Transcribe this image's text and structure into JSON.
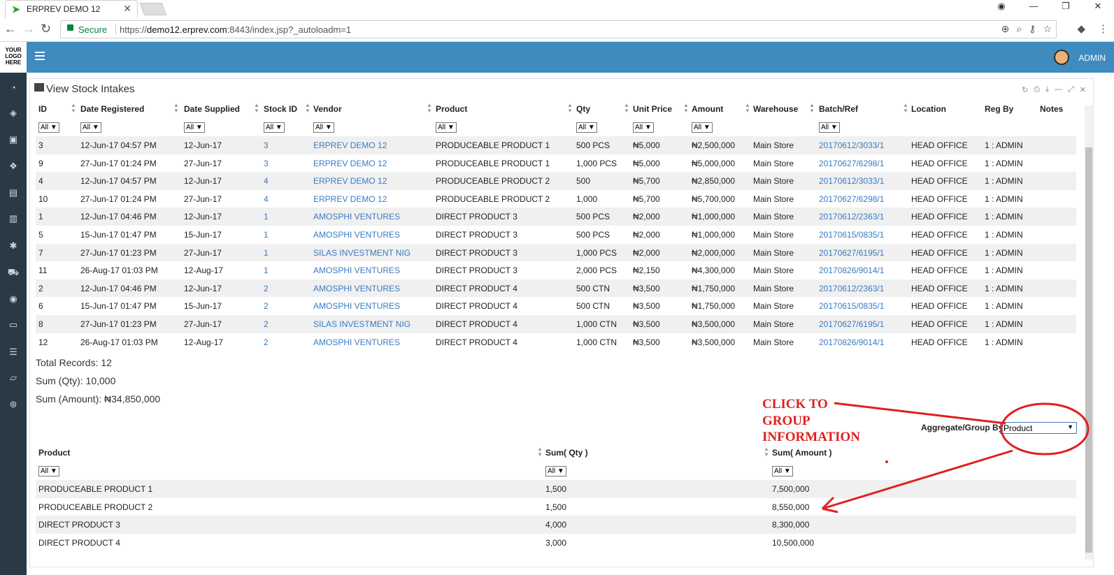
{
  "browser": {
    "tab_title": "ERPREV DEMO 12",
    "secure_label": "Secure",
    "url_scheme": "https://",
    "url_host": "demo12.erprev.com",
    "url_rest": ":8443/index.jsp?_autoloadm=1"
  },
  "app": {
    "logo_text": "YOUR LOGO HERE",
    "user": "ADMIN",
    "panel_title": "View Stock Intakes"
  },
  "table": {
    "columns": [
      "ID",
      "Date Registered",
      "Date Supplied",
      "Stock ID",
      "Vendor",
      "Product",
      "Qty",
      "Unit Price",
      "Amount",
      "Warehouse",
      "Batch/Ref",
      "Location",
      "Reg By",
      "Notes"
    ],
    "filter_label": "All",
    "rows": [
      [
        "3",
        "12-Jun-17 04:57 PM",
        "12-Jun-17",
        "3",
        "ERPREV DEMO 12",
        "PRODUCEABLE PRODUCT 1",
        "500 PCS",
        "₦5,000",
        "₦2,500,000",
        "Main Store",
        "20170612/3033/1",
        "HEAD OFFICE",
        "1 : ADMIN"
      ],
      [
        "9",
        "27-Jun-17 01:24 PM",
        "27-Jun-17",
        "3",
        "ERPREV DEMO 12",
        "PRODUCEABLE PRODUCT 1",
        "1,000 PCS",
        "₦5,000",
        "₦5,000,000",
        "Main Store",
        "20170627/6298/1",
        "HEAD OFFICE",
        "1 : ADMIN"
      ],
      [
        "4",
        "12-Jun-17 04:57 PM",
        "12-Jun-17",
        "4",
        "ERPREV DEMO 12",
        "PRODUCEABLE PRODUCT 2",
        "500",
        "₦5,700",
        "₦2,850,000",
        "Main Store",
        "20170612/3033/1",
        "HEAD OFFICE",
        "1 : ADMIN"
      ],
      [
        "10",
        "27-Jun-17 01:24 PM",
        "27-Jun-17",
        "4",
        "ERPREV DEMO 12",
        "PRODUCEABLE PRODUCT 2",
        "1,000",
        "₦5,700",
        "₦5,700,000",
        "Main Store",
        "20170627/6298/1",
        "HEAD OFFICE",
        "1 : ADMIN"
      ],
      [
        "1",
        "12-Jun-17 04:46 PM",
        "12-Jun-17",
        "1",
        "AMOSPHI VENTURES",
        "DIRECT PRODUCT 3",
        "500 PCS",
        "₦2,000",
        "₦1,000,000",
        "Main Store",
        "20170612/2363/1",
        "HEAD OFFICE",
        "1 : ADMIN"
      ],
      [
        "5",
        "15-Jun-17 01:47 PM",
        "15-Jun-17",
        "1",
        "AMOSPHI VENTURES",
        "DIRECT PRODUCT 3",
        "500 PCS",
        "₦2,000",
        "₦1,000,000",
        "Main Store",
        "20170615/0835/1",
        "HEAD OFFICE",
        "1 : ADMIN"
      ],
      [
        "7",
        "27-Jun-17 01:23 PM",
        "27-Jun-17",
        "1",
        "SILAS INVESTMENT NIG",
        "DIRECT PRODUCT 3",
        "1,000 PCS",
        "₦2,000",
        "₦2,000,000",
        "Main Store",
        "20170627/6195/1",
        "HEAD OFFICE",
        "1 : ADMIN"
      ],
      [
        "11",
        "26-Aug-17 01:03 PM",
        "12-Aug-17",
        "1",
        "AMOSPHI VENTURES",
        "DIRECT PRODUCT 3",
        "2,000 PCS",
        "₦2,150",
        "₦4,300,000",
        "Main Store",
        "20170826/9014/1",
        "HEAD OFFICE",
        "1 : ADMIN"
      ],
      [
        "2",
        "12-Jun-17 04:46 PM",
        "12-Jun-17",
        "2",
        "AMOSPHI VENTURES",
        "DIRECT PRODUCT 4",
        "500 CTN",
        "₦3,500",
        "₦1,750,000",
        "Main Store",
        "20170612/2363/1",
        "HEAD OFFICE",
        "1 : ADMIN"
      ],
      [
        "6",
        "15-Jun-17 01:47 PM",
        "15-Jun-17",
        "2",
        "AMOSPHI VENTURES",
        "DIRECT PRODUCT 4",
        "500 CTN",
        "₦3,500",
        "₦1,750,000",
        "Main Store",
        "20170615/0835/1",
        "HEAD OFFICE",
        "1 : ADMIN"
      ],
      [
        "8",
        "27-Jun-17 01:23 PM",
        "27-Jun-17",
        "2",
        "SILAS INVESTMENT NIG",
        "DIRECT PRODUCT 4",
        "1,000 CTN",
        "₦3,500",
        "₦3,500,000",
        "Main Store",
        "20170627/6195/1",
        "HEAD OFFICE",
        "1 : ADMIN"
      ],
      [
        "12",
        "26-Aug-17 01:03 PM",
        "12-Aug-17",
        "2",
        "AMOSPHI VENTURES",
        "DIRECT PRODUCT 4",
        "1,000 CTN",
        "₦3,500",
        "₦3,500,000",
        "Main Store",
        "20170826/9014/1",
        "HEAD OFFICE",
        "1 : ADMIN"
      ]
    ]
  },
  "summary": {
    "total_records": "Total Records: 12",
    "sum_qty": "Sum (Qty): 10,000",
    "sum_amount": "Sum (Amount): ₦34,850,000"
  },
  "aggregate": {
    "label": "Aggregate/Group By",
    "selected": "Product",
    "columns": [
      "Product",
      "Sum( Qty )",
      "Sum( Amount )"
    ],
    "rows": [
      [
        "PRODUCEABLE PRODUCT 1",
        "1,500",
        "7,500,000"
      ],
      [
        "PRODUCEABLE PRODUCT 2",
        "1,500",
        "8,550,000"
      ],
      [
        "DIRECT PRODUCT 3",
        "4,000",
        "8,300,000"
      ],
      [
        "DIRECT PRODUCT 4",
        "3,000",
        "10,500,000"
      ]
    ]
  },
  "annotation": {
    "lines": [
      "CLICK TO",
      "GROUP",
      "INFORMATION"
    ],
    "color": "#e0201e"
  }
}
